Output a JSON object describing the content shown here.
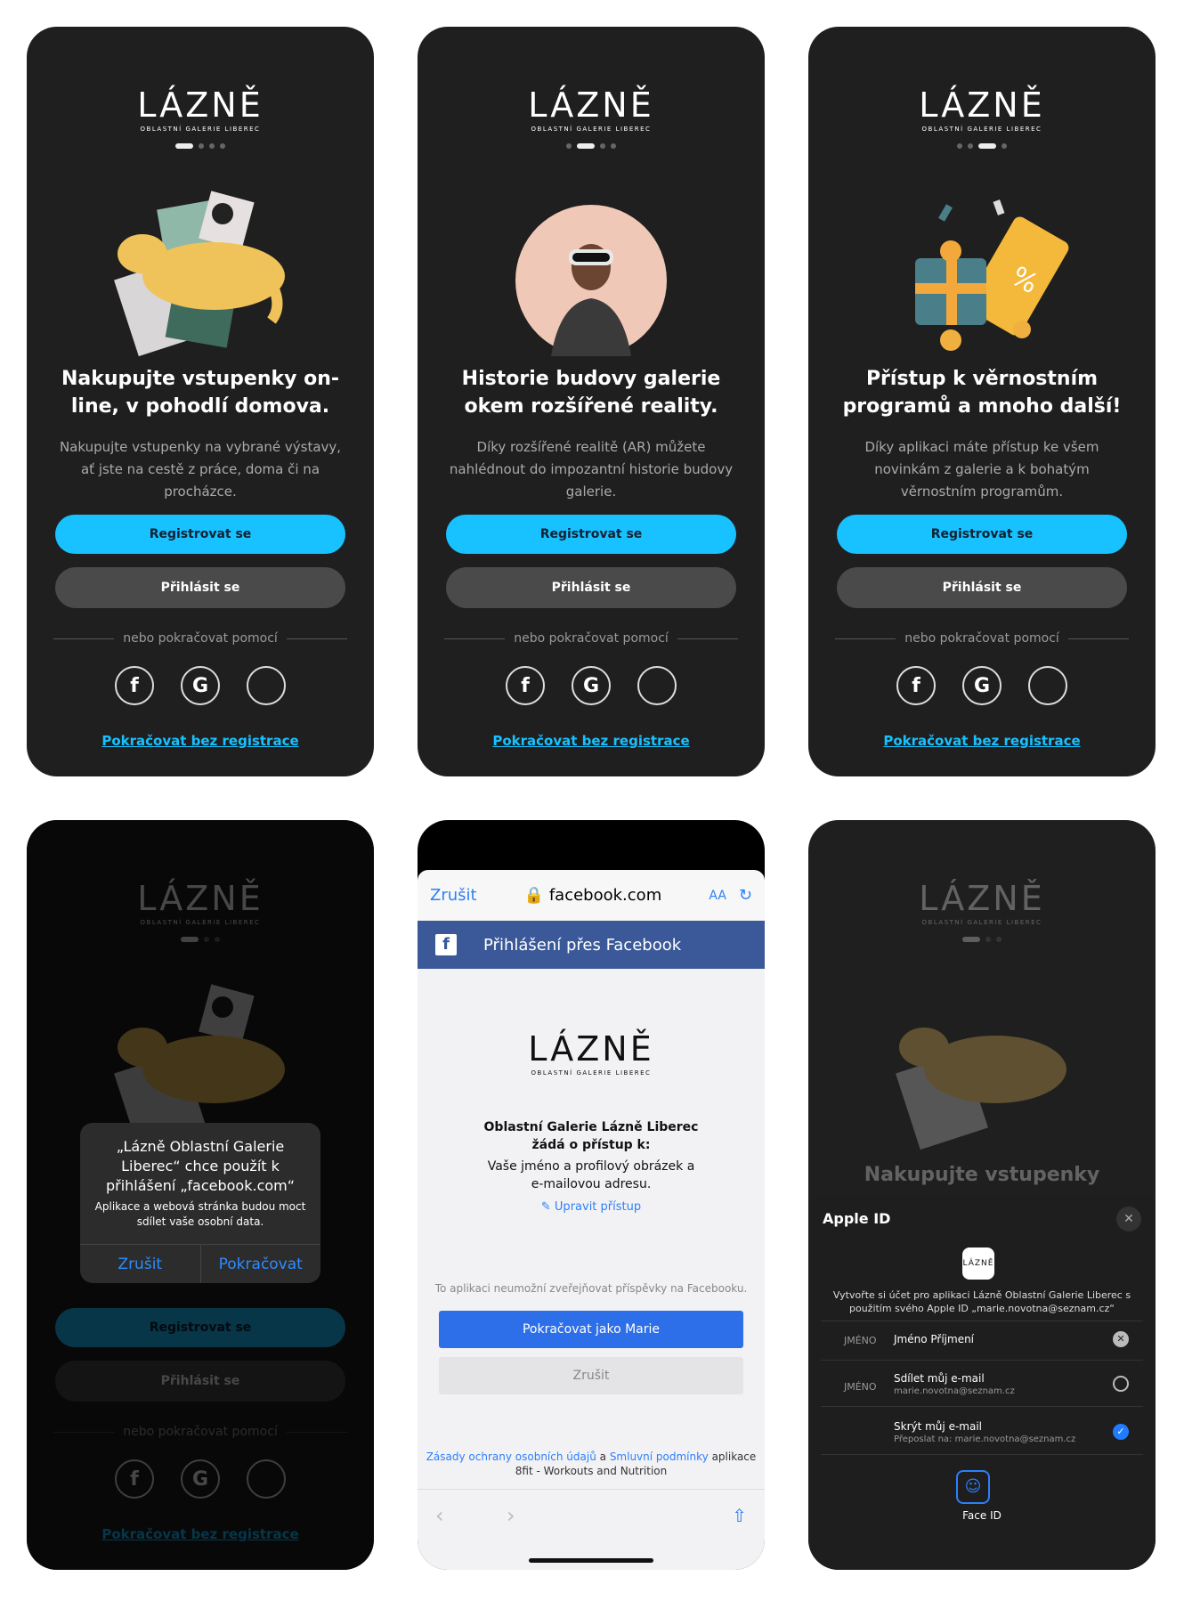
{
  "brand": {
    "name": "LÁZNĚ",
    "subtitle": "OBLASTNÍ GALERIE LIBEREC"
  },
  "buttons": {
    "register": "Registrovat se",
    "login": "Přihlásit se"
  },
  "divider": "nebo pokračovat pomocí",
  "skip": "Pokračovat bez registrace",
  "social": {
    "fb_icon": "facebook-icon",
    "google_icon": "google-icon",
    "apple_icon": "apple-icon"
  },
  "colors": {
    "accent": "#18c1ff",
    "bg": "#1f1f1f",
    "fb": "#3b5998"
  },
  "slides": [
    {
      "title": "Nakupujte vstupenky on-line, v pohodlí domova.",
      "desc": "Nakupujte vstupenky na vybrané výstavy, ať jste na cestě z práce, doma či na procházce.",
      "active": 0
    },
    {
      "title": "Historie budovy galerie okem rozšířené reality.",
      "desc": "Díky rozšířené realitě (AR) můžete nahlédnout do impozantní historie budovy galerie.",
      "active": 1
    },
    {
      "title": "Přístup k věrnostním programů a mnoho další!",
      "desc": "Díky aplikaci máte přístup ke všem novinkám z galerie a k bohatým věrnostním programům.",
      "active": 2
    }
  ],
  "alert": {
    "title": "„Lázně Oblastní Galerie Liberec“ chce použít k přihlášení „facebook.com“",
    "message": "Aplikace a webová stránka budou moct sdílet vaše osobní data.",
    "cancel": "Zrušit",
    "continue": "Pokračovat"
  },
  "facebook": {
    "cancel": "Zrušit",
    "domain": "facebook.com",
    "aa": "AA",
    "header": "Přihlášení přes Facebook",
    "request_title": "Oblastní Galerie Lázně Liberec žádá o přístup k:",
    "request_body": "Vaše jméno a profilový obrázek a e-mailovou adresu.",
    "edit": "Upravit přístup",
    "notice": "To aplikaci neumožní zveřejňovat příspěvky na Facebooku.",
    "continue": "Pokračovat jako Marie",
    "cancel_btn": "Zrušit",
    "footer_a": "Zásady ochrany osobních údajů",
    "footer_and": "a",
    "footer_b": "Smluvní podmínky",
    "footer_c": "aplikace 8fit - Workouts and Nutrition"
  },
  "apple": {
    "faded_title": "Nakupujte vstupenky",
    "title": "Apple ID",
    "app_logo": "LÁZNĚ",
    "intro": "Vytvořte si účet pro aplikaci Lázně Oblastní Galerie Liberec s použitím svého Apple ID „marie.novotna@seznam.cz“",
    "name_label": "JMÉNO",
    "name_value": "Jméno Příjmení",
    "email_label": "JMÉNO",
    "share": "Sdílet můj e-mail",
    "share_sub": "marie.novotna@seznam.cz",
    "hide": "Skrýt můj e-mail",
    "hide_sub": "Přeposlat na: marie.novotna@seznam.cz",
    "faceid": "Face ID"
  }
}
